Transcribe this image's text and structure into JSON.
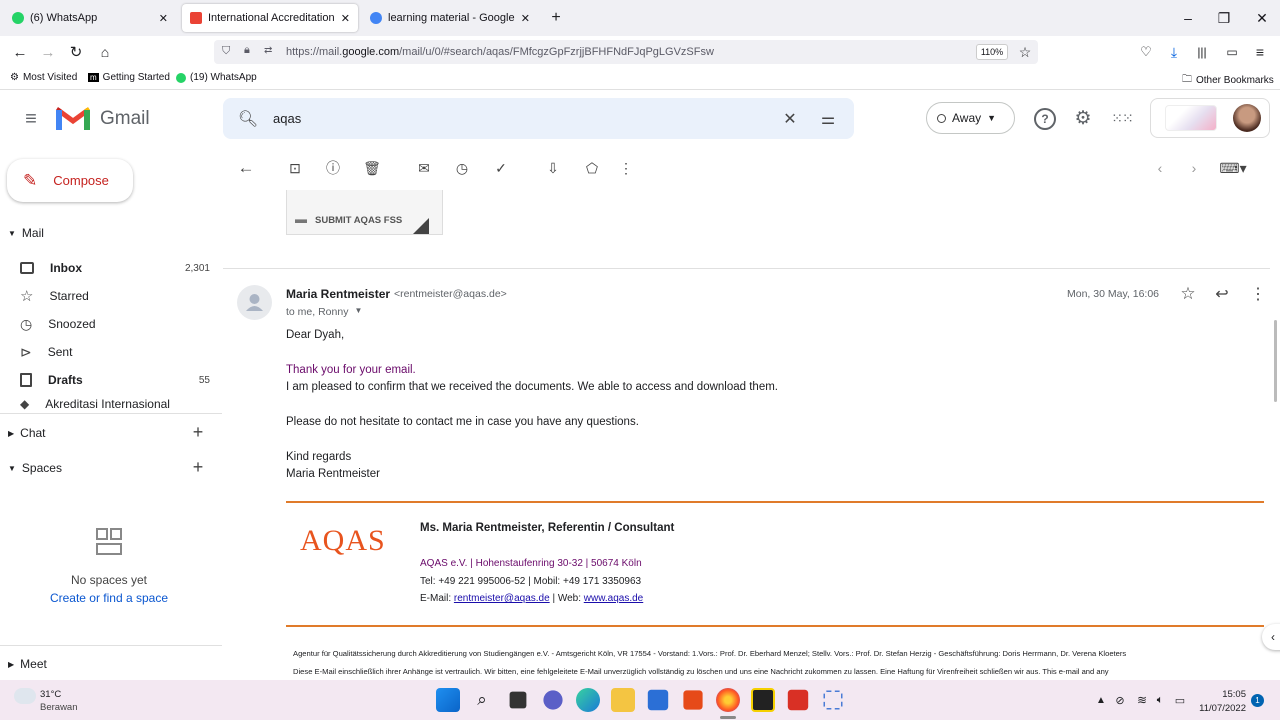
{
  "browser": {
    "tabs": [
      {
        "title": "(6) WhatsApp",
        "color": "#25d366"
      },
      {
        "title": "International Accreditation Club",
        "color": "#ea4335"
      },
      {
        "title": "learning material - Google Search",
        "color": "#4285f4"
      }
    ],
    "url_prefix": "https://mail.",
    "url_domain": "google.com",
    "url_rest": "/mail/u/0/#search/aqas/FMfcgzGpFzrjjBFHFNdFJqPgLGVzSFsw",
    "zoom": "110%",
    "bookmarks": [
      "Most Visited",
      "Getting Started",
      "(19) WhatsApp"
    ],
    "other_bookmarks": "Other Bookmarks"
  },
  "gmail": {
    "logo_text": "Gmail",
    "search_value": "aqas",
    "status": "Away",
    "compose": "Compose",
    "mail_section": "Mail",
    "sidebar": [
      {
        "label": "Inbox",
        "count": "2,301",
        "bold": true,
        "icon": "inbox-icon"
      },
      {
        "label": "Starred",
        "count": "",
        "bold": false,
        "icon": "star-icon"
      },
      {
        "label": "Snoozed",
        "count": "",
        "bold": false,
        "icon": "clock-icon"
      },
      {
        "label": "Sent",
        "count": "",
        "bold": false,
        "icon": "send-icon"
      },
      {
        "label": "Drafts",
        "count": "55",
        "bold": true,
        "icon": "draft-icon"
      },
      {
        "label": "Akreditasi Internasional",
        "count": "",
        "bold": false,
        "icon": "label-icon"
      }
    ],
    "chat_section": "Chat",
    "spaces_section": "Spaces",
    "no_spaces": "No spaces yet",
    "create_space": "Create or find a space",
    "meet_section": "Meet",
    "attachment_label": "SUBMIT AQAS FSS"
  },
  "email": {
    "sender_name": "Maria Rentmeister",
    "sender_email": "<rentmeister@aqas.de>",
    "recipients": "to me, Ronny",
    "date": "Mon, 30 May, 16:06",
    "greeting": "Dear Dyah,",
    "line1": "Thank you for your email.",
    "line2": "I am pleased to confirm that we received the documents. We able to access and download them.",
    "line3": "Please do not hesitate to contact me in case you have any questions.",
    "closing1": "Kind regards",
    "closing2": "Maria Rentmeister",
    "sig_logo": "AQAS",
    "sig_name": "Ms. Maria Rentmeister, Referentin / Consultant",
    "sig_address": "AQAS e.V. | Hohenstaufenring 30-32 | 50674 Köln",
    "sig_phone": "Tel: +49 221 995006-52 | Mobil: +49 171 3350963",
    "sig_email_label": "E-Mail: ",
    "sig_email": "rentmeister@aqas.de",
    "sig_web_label": " | Web: ",
    "sig_web": "www.aqas.de",
    "footer1": "Agentur für Qualitätssicherung durch Akkreditierung von Studiengängen e.V. - Amtsgericht Köln, VR 17554 - Vorstand: 1.Vors.: Prof. Dr. Eberhard Menzel; Stellv. Vors.: Prof. Dr. Stefan Herzig - Geschäftsführung: Doris Herrmann, Dr. Verena Kloeters",
    "footer2": "Diese E-Mail einschließlich ihrer Anhänge ist vertraulich. Wir bitten, eine fehlgeleitete E-Mail unverzüglich vollständig zu löschen und uns eine Nachricht zukommen zu lassen. Eine Haftung für Virenfreiheit schließen wir aus. This e-mail and any"
  },
  "taskbar": {
    "temp": "31°C",
    "weather": "Berawan",
    "time": "15:05",
    "date": "11/07/2022",
    "notif_count": "1"
  }
}
